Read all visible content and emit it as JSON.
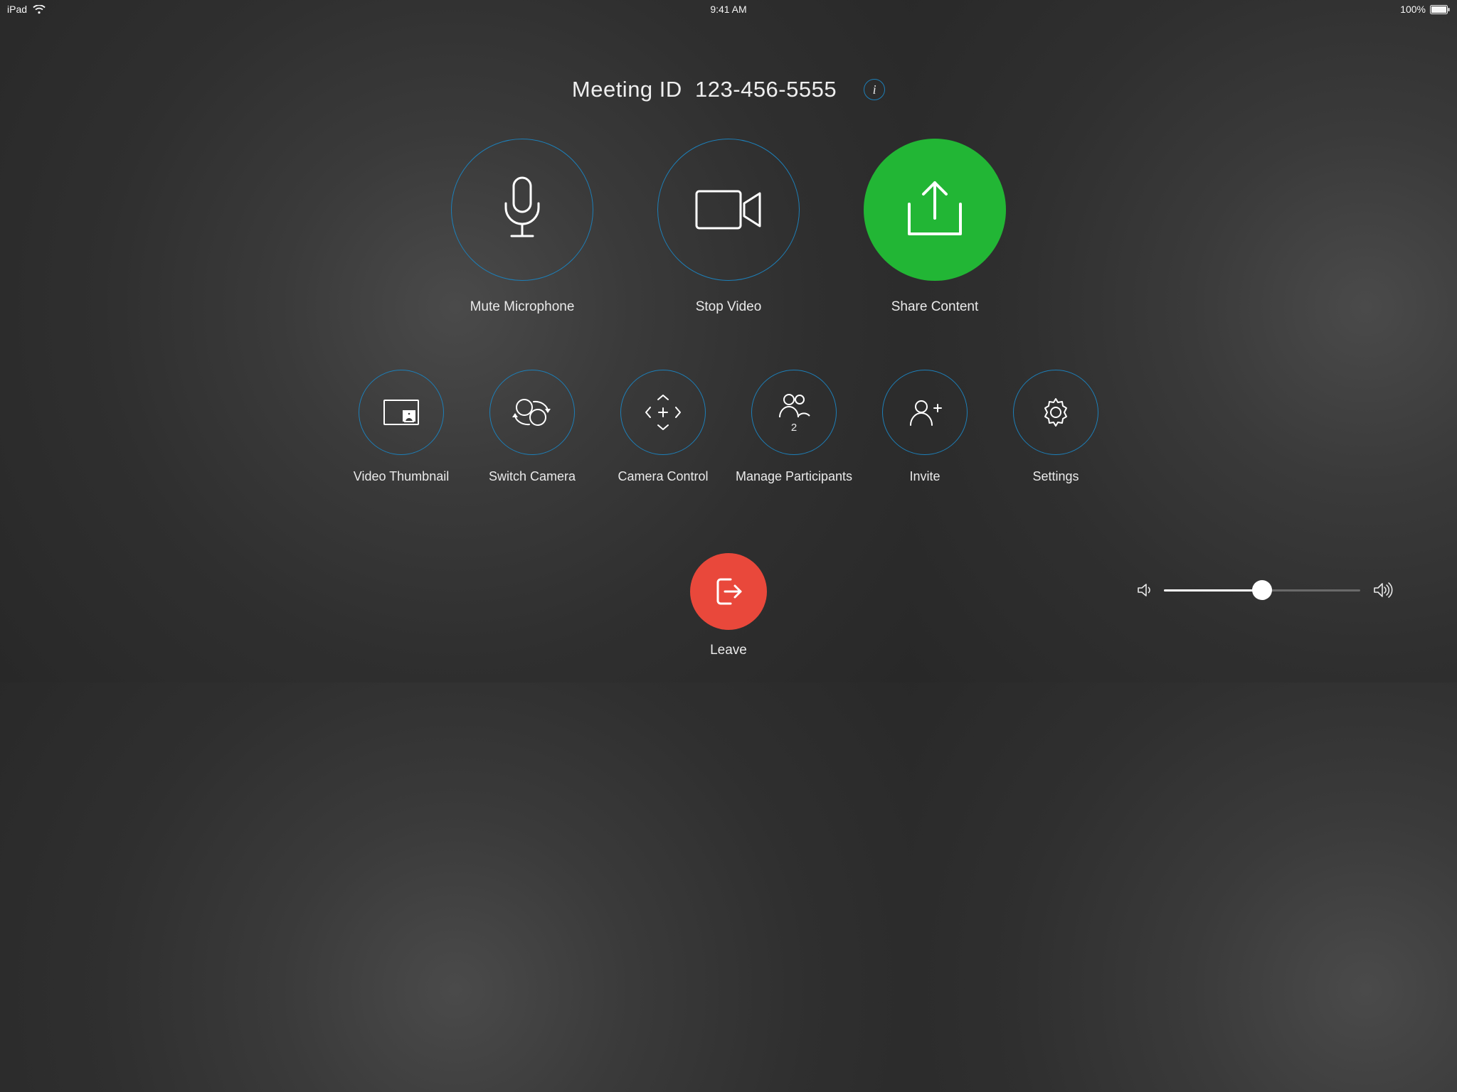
{
  "status": {
    "device": "iPad",
    "time": "9:41 AM",
    "battery_text": "100%"
  },
  "header": {
    "meeting_label": "Meeting ID",
    "meeting_id": "123-456-5555"
  },
  "primary": {
    "mute": "Mute Microphone",
    "stop_video": "Stop Video",
    "share": "Share Content"
  },
  "secondary": {
    "video_thumb": "Video Thumbnail",
    "switch_camera": "Switch Camera",
    "camera_control": "Camera Control",
    "manage_participants": "Manage Participants",
    "participants_count": "2",
    "invite": "Invite",
    "settings": "Settings"
  },
  "bottom": {
    "leave": "Leave",
    "volume_percent": 50
  },
  "colors": {
    "accent_outline": "#1d7fb8",
    "share_green": "#22b635",
    "leave_red": "#e9483b"
  }
}
